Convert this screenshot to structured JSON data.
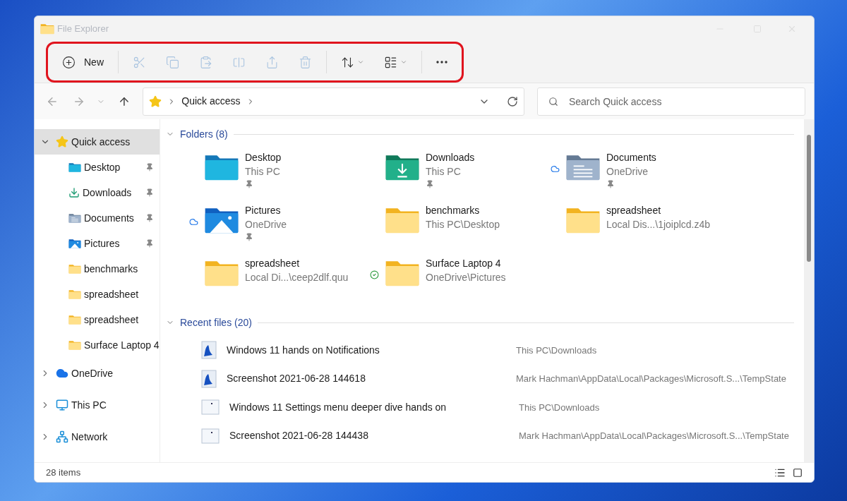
{
  "window": {
    "title": "File Explorer"
  },
  "toolbar": [
    {
      "kind": "new",
      "label": "New",
      "disabled": false
    },
    {
      "kind": "cut",
      "disabled": true
    },
    {
      "kind": "copy",
      "disabled": true
    },
    {
      "kind": "paste",
      "disabled": true
    },
    {
      "kind": "rename",
      "disabled": true
    },
    {
      "kind": "share",
      "disabled": true
    },
    {
      "kind": "delete",
      "disabled": true
    },
    {
      "kind": "sort",
      "disabled": false
    },
    {
      "kind": "view",
      "disabled": false
    },
    {
      "kind": "more",
      "disabled": false
    }
  ],
  "address_bar": {
    "path": [
      "Quick access"
    ]
  },
  "search": {
    "placeholder": "Search Quick access"
  },
  "sidebar": {
    "items": [
      {
        "label": "Quick access",
        "kind": "star",
        "selected": true,
        "expanded": true,
        "children": [
          {
            "label": "Desktop",
            "kind": "desktop",
            "pinned": true,
            "selected": false
          },
          {
            "label": "Downloads",
            "kind": "downloads",
            "pinned": true,
            "selected": false
          },
          {
            "label": "Documents",
            "kind": "documents",
            "pinned": true,
            "selected": false
          },
          {
            "label": "Pictures",
            "kind": "pictures",
            "pinned": true,
            "selected": false
          },
          {
            "label": "benchmarks",
            "kind": "folder",
            "pinned": false,
            "selected": false
          },
          {
            "label": "spreadsheet",
            "kind": "folder",
            "pinned": false,
            "selected": false
          },
          {
            "label": "spreadsheet",
            "kind": "folder",
            "pinned": false,
            "selected": false
          },
          {
            "label": "Surface Laptop 4",
            "kind": "folder",
            "pinned": false,
            "selected": false
          }
        ]
      },
      {
        "label": "OneDrive",
        "kind": "cloud",
        "selected": false,
        "expanded": false
      },
      {
        "label": "This PC",
        "kind": "pc",
        "selected": false,
        "expanded": false
      },
      {
        "label": "Network",
        "kind": "network",
        "selected": false,
        "expanded": false
      }
    ]
  },
  "folders": {
    "heading": "Folders (8)",
    "expanded": true,
    "items": [
      {
        "name": "Desktop",
        "location": "This PC",
        "kind": "desktop",
        "pinned": true,
        "cloud_only": false,
        "synced": false
      },
      {
        "name": "Downloads",
        "location": "This PC",
        "kind": "downloads",
        "pinned": true,
        "cloud_only": false,
        "synced": false
      },
      {
        "name": "Documents",
        "location": "OneDrive",
        "kind": "documents",
        "pinned": true,
        "cloud_only": true,
        "synced": false
      },
      {
        "name": "Pictures",
        "location": "OneDrive",
        "kind": "pictures",
        "pinned": true,
        "cloud_only": true,
        "synced": false
      },
      {
        "name": "benchmarks",
        "location": "This PC\\Desktop",
        "kind": "folder",
        "pinned": false,
        "cloud_only": false,
        "synced": false
      },
      {
        "name": "spreadsheet",
        "location": "Local Dis...\\1joiplcd.z4b",
        "kind": "folder",
        "pinned": false,
        "cloud_only": false,
        "synced": false
      },
      {
        "name": "spreadsheet",
        "location": "Local Di...\\ceep2dlf.quu",
        "kind": "folder",
        "pinned": false,
        "cloud_only": false,
        "synced": false
      },
      {
        "name": "Surface Laptop 4",
        "location": "OneDrive\\Pictures",
        "kind": "folder",
        "pinned": false,
        "cloud_only": false,
        "synced": true
      }
    ]
  },
  "recent_files": {
    "heading": "Recent files (20)",
    "expanded": true,
    "items": [
      {
        "name": "Windows 11 hands on Notifications",
        "location": "This PC\\Downloads",
        "kind": "image"
      },
      {
        "name": "Screenshot 2021-06-28 144618",
        "location": "Mark Hachman\\AppData\\Local\\Packages\\Microsoft.S...\\TempState",
        "kind": "image"
      },
      {
        "name": "Windows 11 Settings menu deeper dive hands on",
        "location": "This PC\\Downloads",
        "kind": "blank"
      },
      {
        "name": "Screenshot 2021-06-28 144438",
        "location": "Mark Hachman\\AppData\\Local\\Packages\\Microsoft.S...\\TempState",
        "kind": "blank"
      }
    ]
  },
  "status_bar": {
    "count": "28 items"
  }
}
